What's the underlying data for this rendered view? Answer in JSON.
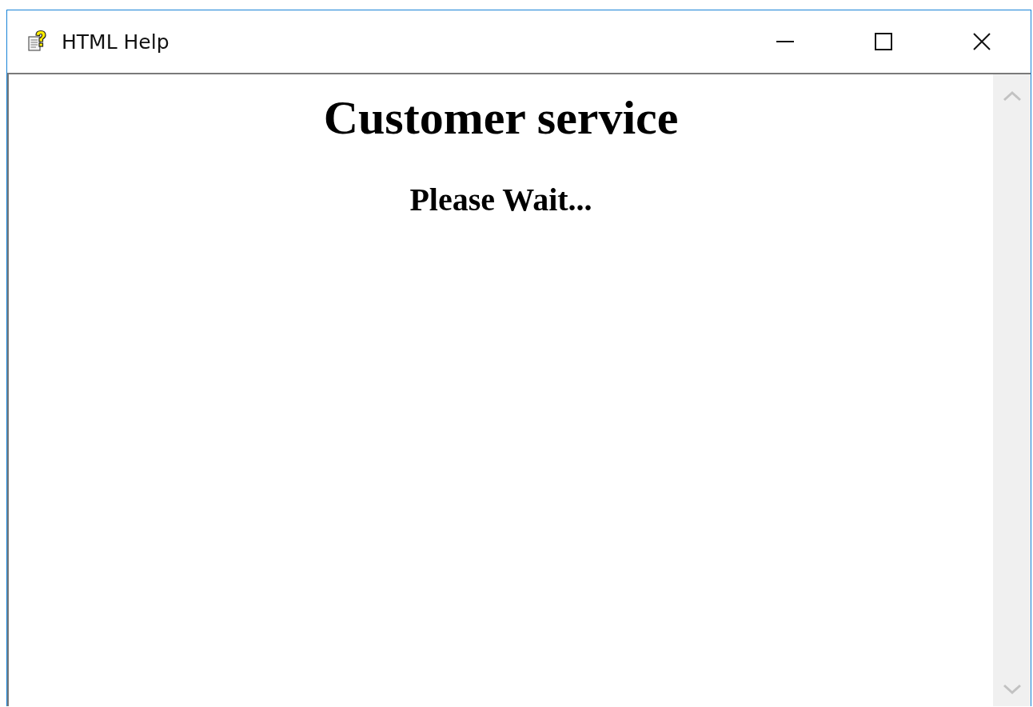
{
  "window": {
    "title": "HTML Help"
  },
  "content": {
    "heading": "Customer service",
    "subheading": "Please Wait..."
  }
}
